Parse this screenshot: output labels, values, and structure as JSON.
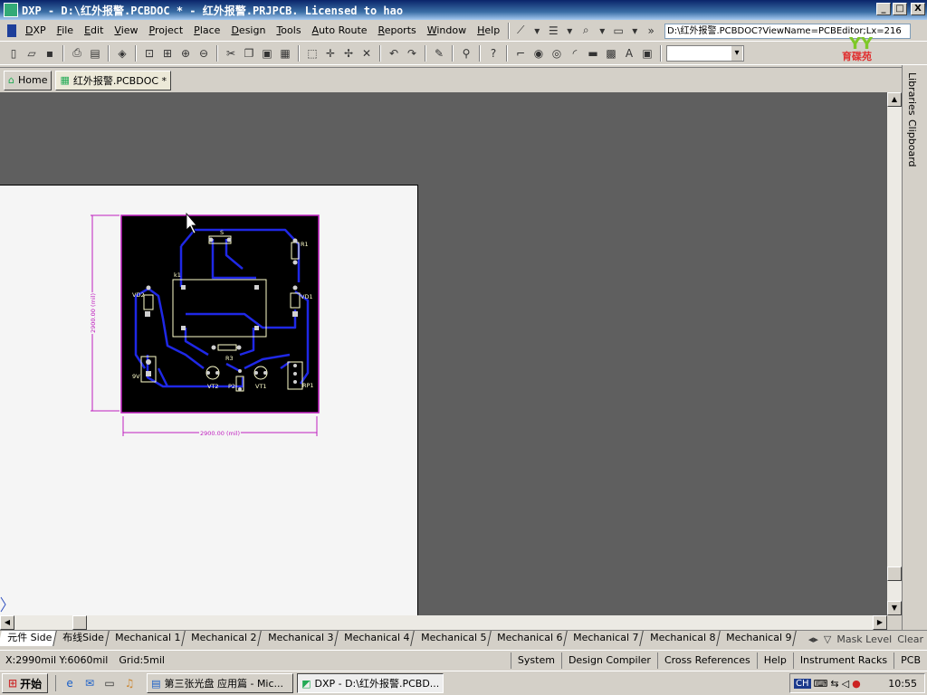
{
  "window": {
    "title": "DXP - D:\\红外报警.PCBDOC * - 红外报警.PRJPCB. Licensed to hao",
    "minimize": "_",
    "maximize": "□",
    "close": "X"
  },
  "menu": [
    "DXP",
    "File",
    "Edit",
    "View",
    "Project",
    "Place",
    "Design",
    "Tools",
    "Auto Route",
    "Reports",
    "Window",
    "Help"
  ],
  "address": "D:\\红外报警.PCBDOC?ViewName=PCBEditor;Lx=216",
  "tabs": {
    "home": "Home",
    "doc": "红外报警.PCBDOC *"
  },
  "side_tabs": [
    "Libraries",
    "Clipboard"
  ],
  "pcb": {
    "dim_horizontal": "2900.00 (mil)",
    "dim_vertical": "2900.00 (mil)",
    "labels": {
      "s": "S",
      "r1": "R1",
      "k1": "k1",
      "vd2": "VD2",
      "vd1": "VD1",
      "r3": "R3",
      "g9v": "9V",
      "vt2": "VT2",
      "vt1": "VT1",
      "p2": "P2",
      "rp1": "RP1"
    }
  },
  "layer_tabs": [
    "元件 Side",
    "布线Side",
    "Mechanical 1",
    "Mechanical 2",
    "Mechanical 3",
    "Mechanical 4",
    "Mechanical 5",
    "Mechanical 6",
    "Mechanical 7",
    "Mechanical 8",
    "Mechanical 9"
  ],
  "layer_right": {
    "mask": "Mask Level",
    "clear": "Clear"
  },
  "status": {
    "coords": "X:2990mil Y:6060mil",
    "grid": "Grid:5mil",
    "buttons": [
      "System",
      "Design Compiler",
      "Cross References",
      "Help",
      "Instrument Racks",
      "PCB"
    ]
  },
  "taskbar": {
    "start": "开始",
    "tasks": [
      "第三张光盘 应用篇 - Mic...",
      "DXP - D:\\红外报警.PCBD..."
    ],
    "lang": "CH",
    "clock": "10:55"
  },
  "colors": {
    "board": "#000000",
    "trace": "#1f28e6",
    "silk": "#ffffcc",
    "dimension": "#c020c0",
    "workspace": "#5f5f5f"
  }
}
